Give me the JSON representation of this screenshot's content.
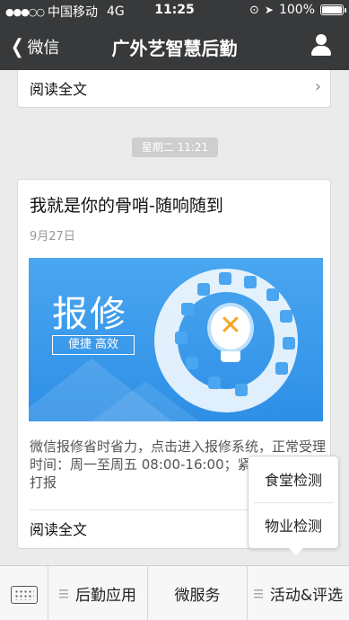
{
  "status_bar": {
    "carrier": "中国移动",
    "network": "4G",
    "time": "11:25",
    "battery": "100%",
    "battery_level": 1.0
  },
  "navbar": {
    "back_label": "微信",
    "title": "广外艺智慧后勤"
  },
  "messages": {
    "prev_card": {
      "read_full": "阅读全文"
    },
    "timestamp": "星期二 11:21",
    "article": {
      "title": "我就是你的骨哨-随响随到",
      "date": "9月27日",
      "banner_title": "报修",
      "banner_sub": "便捷 高效",
      "description": "微信报修省时省力，点击进入报修系统，正常受理时间：周一至周五 08:00-16:00；紧急报修请拨打报",
      "read_full": "阅读全文"
    }
  },
  "popup_menu": {
    "items": [
      "食堂检测",
      "物业检测"
    ]
  },
  "bottom_menu": {
    "items": [
      "后勤应用",
      "微服务",
      "活动&评选"
    ]
  }
}
